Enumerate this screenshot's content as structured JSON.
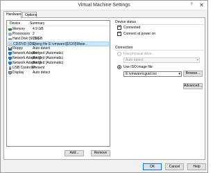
{
  "window": {
    "title": "Virtual Machine Settings"
  },
  "tabs": [
    {
      "label": "Hardware",
      "active": true
    },
    {
      "label": "Options",
      "active": false
    }
  ],
  "device_list": {
    "columns": [
      "Device",
      "Summary"
    ],
    "rows": [
      {
        "device": "Memory",
        "summary": "4.9 GB",
        "icon": "memory-icon",
        "selected": false
      },
      {
        "device": "Processors",
        "summary": "2",
        "icon": "processor-icon",
        "selected": false
      },
      {
        "device": "Hard Disk (SCSI)",
        "summary": "70 GB",
        "icon": "hard-disk-icon",
        "selected": false
      },
      {
        "device": "CD/DVD (IDE)",
        "summary": "Using file E:\\vmware\\[ESXI]\\Mwar...",
        "icon": "cd-dvd-icon",
        "selected": true
      },
      {
        "device": "Floppy",
        "summary": "Auto detect",
        "icon": "floppy-icon",
        "selected": false
      },
      {
        "device": "Network Adapter",
        "summary": "Bridged (Automatic)",
        "icon": "network-adapter-icon",
        "selected": false
      },
      {
        "device": "Network Adapter 2",
        "summary": "Bridged (Automatic)",
        "icon": "network-adapter-icon",
        "selected": false
      },
      {
        "device": "Network Adapter 3",
        "summary": "Bridged (Automatic)",
        "icon": "network-adapter-icon",
        "selected": false
      },
      {
        "device": "USB Controller",
        "summary": "Present",
        "icon": "usb-icon",
        "selected": false
      },
      {
        "device": "Display",
        "summary": "Auto detect",
        "icon": "display-icon",
        "selected": false
      }
    ],
    "add_label": "Add...",
    "remove_label": "Remove"
  },
  "device_status": {
    "heading": "Device status",
    "connected_label": "Connected",
    "connected_checked": true,
    "power_on_label": "Connect at power on",
    "power_on_checked": true
  },
  "connection": {
    "heading": "Connection",
    "physical_label": "Use physical drive:",
    "physical_selected": false,
    "physical_value": "Auto detect",
    "iso_label": "Use ISO image file:",
    "iso_selected": true,
    "iso_value": "E:\\vmware\\cguid.iso",
    "browse_label": "Browse...",
    "advanced_label": "Advanced..."
  },
  "footer": {
    "ok_label": "OK",
    "cancel_label": "Cancel",
    "help_label": "Help"
  },
  "colors": {
    "selection": "#cce8ff",
    "accent": "#0078d7"
  }
}
